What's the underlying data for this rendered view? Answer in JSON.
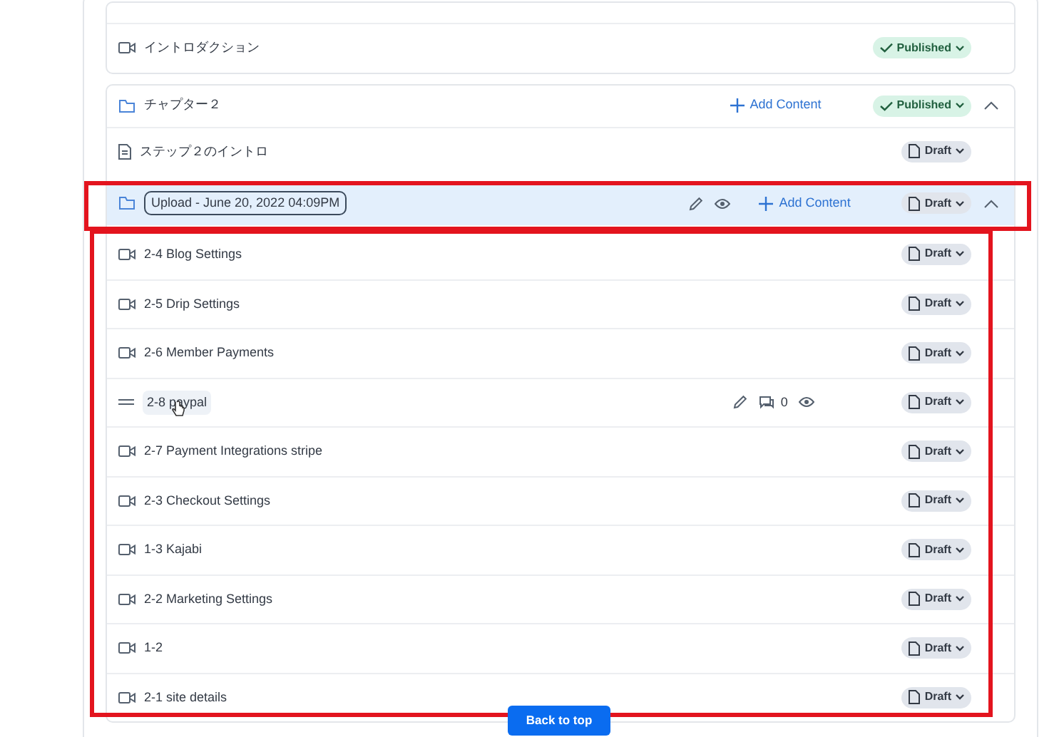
{
  "chapter_1": {
    "lessons": [
      {
        "kind": "video",
        "title": "イントロダクション",
        "status": "Published",
        "published": true
      }
    ]
  },
  "chapter_2": {
    "title": "チャプター２",
    "add_content": "Add Content",
    "status": "Published",
    "published": true,
    "expanded": true,
    "lessons": [
      {
        "kind": "document",
        "title": "ステップ２のイントロ",
        "status": "Draft",
        "published": false
      }
    ]
  },
  "upload_folder": {
    "title": "Upload - June 20, 2022 04:09PM",
    "add_content": "Add Content",
    "status": "Draft",
    "published": false,
    "expanded": true,
    "selected": true,
    "lessons": [
      {
        "kind": "video",
        "title": "2-4 Blog Settings",
        "status": "Draft",
        "published": false
      },
      {
        "kind": "video",
        "title": "2-5 Drip Settings",
        "status": "Draft",
        "published": false
      },
      {
        "kind": "video",
        "title": "2-6 Member Payments",
        "status": "Draft",
        "published": false
      },
      {
        "kind": "drag",
        "title": "2-8 paypal",
        "comments": "0",
        "status": "Draft",
        "published": false
      },
      {
        "kind": "video",
        "title": "2-7 Payment Integrations stripe",
        "status": "Draft",
        "published": false
      },
      {
        "kind": "video",
        "title": "2-3 Checkout Settings",
        "status": "Draft",
        "published": false
      },
      {
        "kind": "video",
        "title": "1-3 Kajabi",
        "status": "Draft",
        "published": false
      },
      {
        "kind": "video",
        "title": "2-2 Marketing Settings",
        "status": "Draft",
        "published": false
      },
      {
        "kind": "video",
        "title": "1-2",
        "status": "Draft",
        "published": false
      },
      {
        "kind": "video",
        "title": "2-1 site details",
        "status": "Draft",
        "published": false
      }
    ]
  },
  "back_to_top": "Back to top"
}
